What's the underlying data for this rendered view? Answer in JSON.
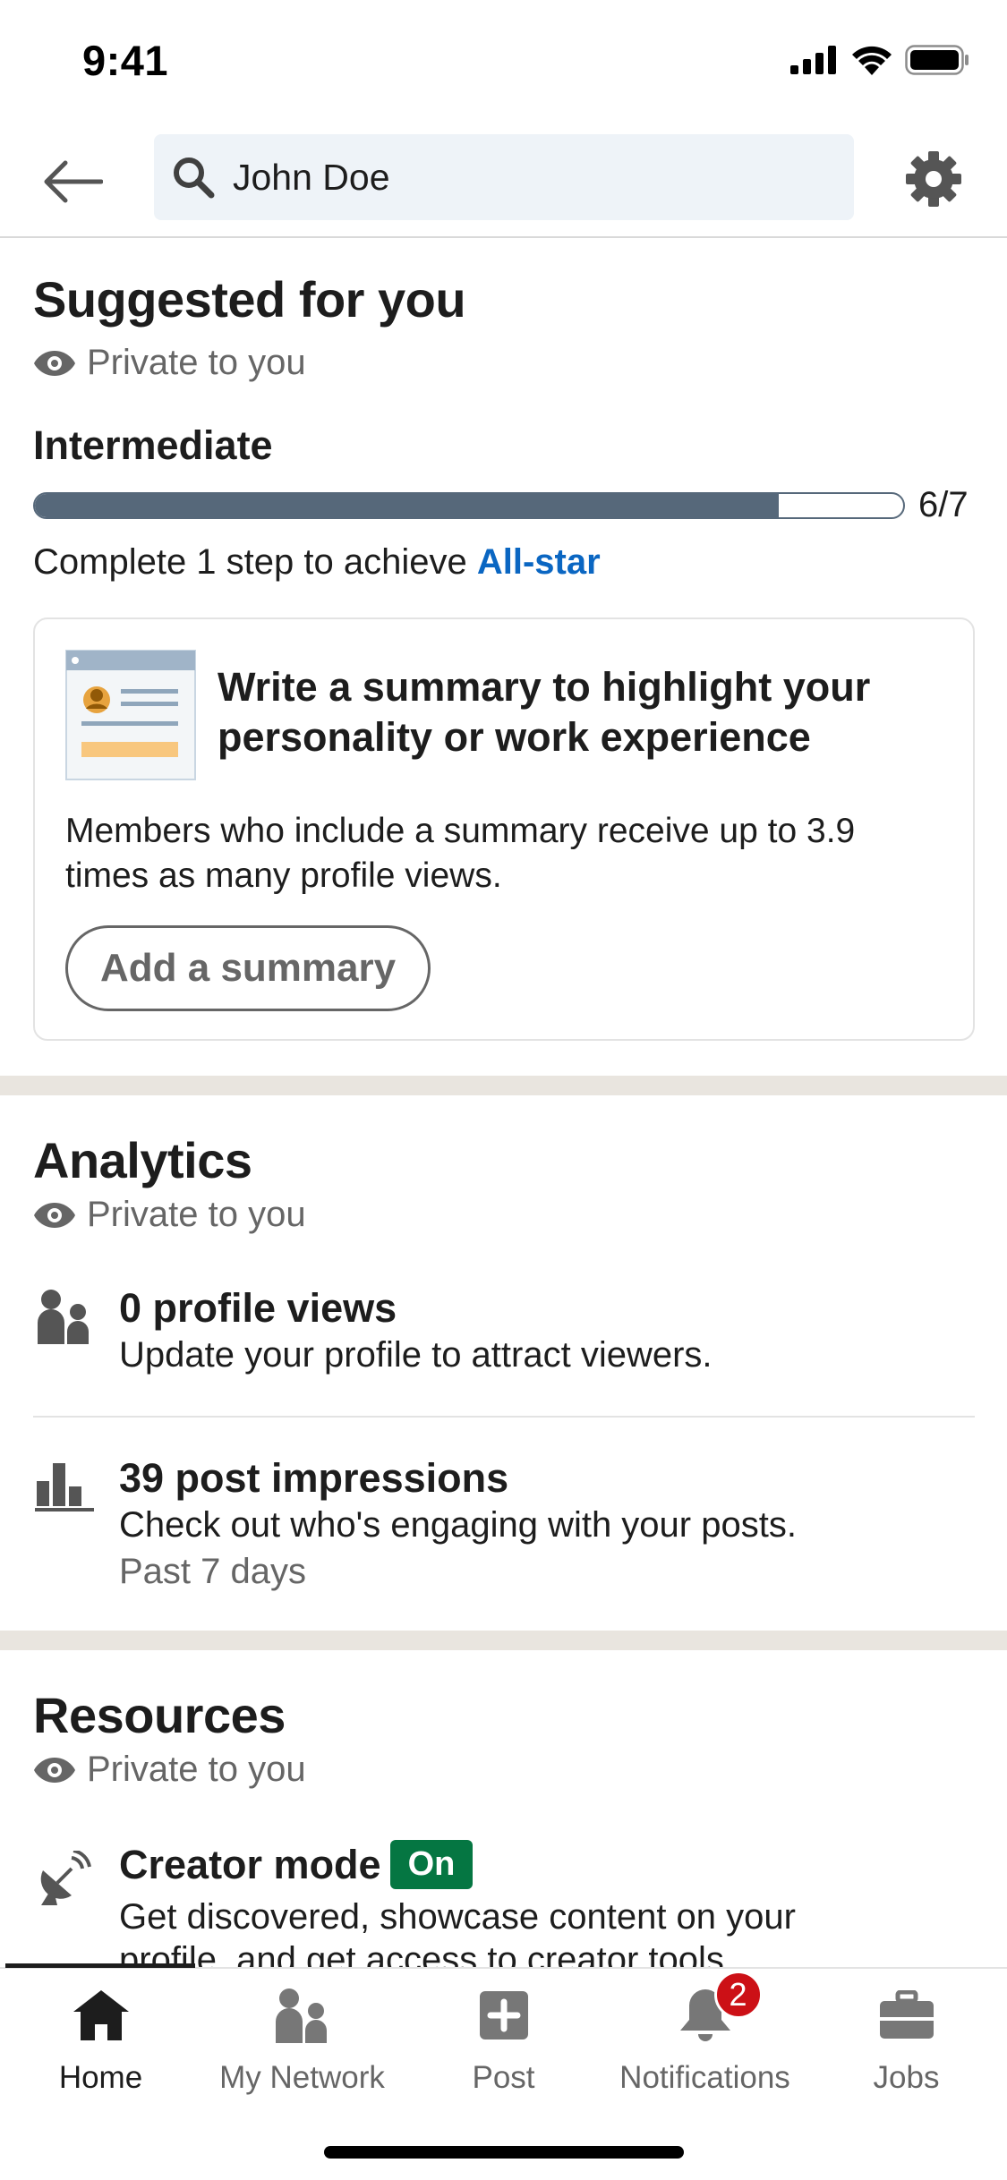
{
  "status_bar": {
    "time": "9:41"
  },
  "search": {
    "value": "John Doe"
  },
  "colors": {
    "accent": "#0a66c2",
    "progress": "#56687a",
    "on_badge": "#057642",
    "notification_badge": "#cc1016",
    "band": "#e9e5df"
  },
  "suggested": {
    "title": "Suggested for you",
    "privacy": "Private to you",
    "level": "Intermediate",
    "progress": {
      "current": 6,
      "total": 7,
      "label": "6/7"
    },
    "achieve_prefix": "Complete 1 step to achieve ",
    "achieve_link": "All-star",
    "card": {
      "title": "Write a summary to highlight your personality or work experience",
      "body": "Members who include a summary receive up to 3.9 times as many profile views.",
      "button": "Add a summary"
    }
  },
  "analytics": {
    "title": "Analytics",
    "privacy": "Private to you",
    "items": [
      {
        "icon": "people-icon",
        "title": "0 profile views",
        "subtitle": "Update your profile to attract viewers."
      },
      {
        "icon": "bar-chart-icon",
        "title": "39 post impressions",
        "subtitle": "Check out who's engaging with your posts.",
        "meta": "Past 7 days"
      }
    ]
  },
  "resources": {
    "title": "Resources",
    "privacy": "Private to you",
    "creator": {
      "icon": "satellite-dish-icon",
      "title": "Creator mode",
      "badge": "On",
      "line1": "Get discovered, showcase content on your",
      "line2": "profile, and get access to creator tools."
    }
  },
  "nav": {
    "items": [
      {
        "label": "Home",
        "icon": "home-icon",
        "active": true
      },
      {
        "label": "My Network",
        "icon": "network-icon"
      },
      {
        "label": "Post",
        "icon": "post-icon"
      },
      {
        "label": "Notifications",
        "icon": "bell-icon",
        "badge": "2"
      },
      {
        "label": "Jobs",
        "icon": "briefcase-icon"
      }
    ]
  }
}
